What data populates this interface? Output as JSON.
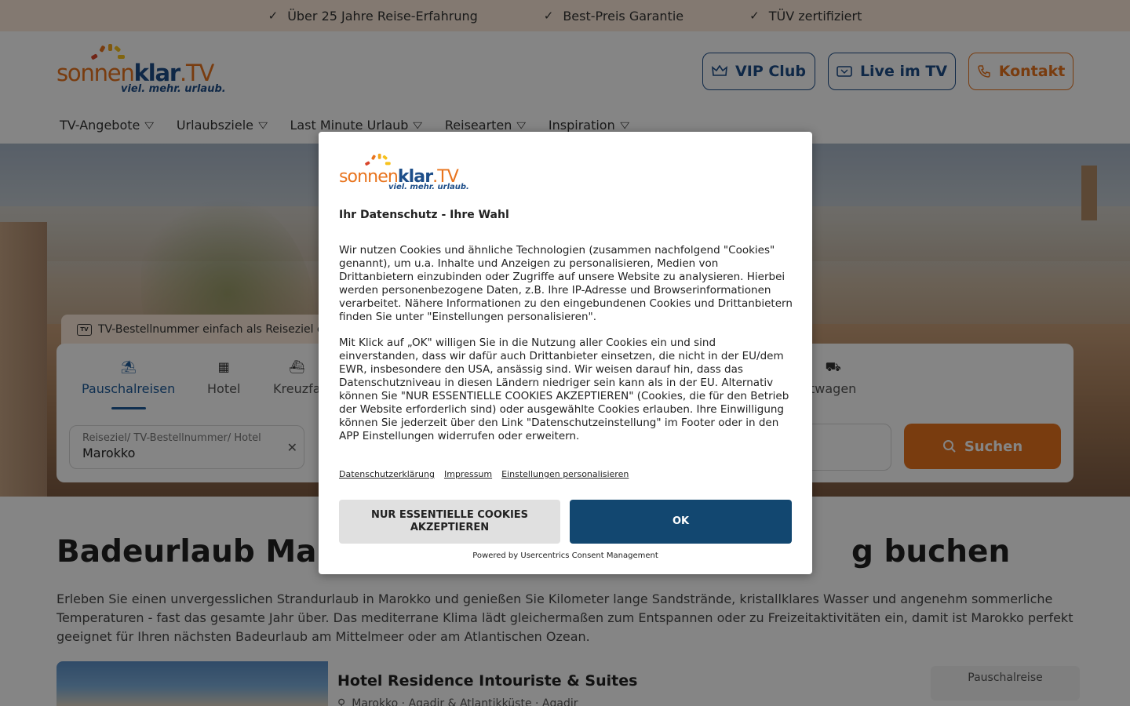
{
  "usp": [
    {
      "label": "Über 25 Jahre Reise-Erfahrung",
      "icon": "check-icon"
    },
    {
      "label": "Best-Preis Garantie",
      "icon": "check-icon"
    },
    {
      "label": "TÜV zertifiziert",
      "icon": "check-icon"
    }
  ],
  "logo": {
    "part1": "sonnen",
    "part2": "klar",
    "part3": ".TV",
    "claim": "viel. mehr. urlaub."
  },
  "header_buttons": {
    "vip": "VIP Club",
    "tv": "Live im TV",
    "kontakt": "Kontakt"
  },
  "nav": [
    "TV-Angebote",
    "Urlaubsziele",
    "Last Minute Urlaub",
    "Reisearten",
    "Inspiration"
  ],
  "search": {
    "tv_hint": "TV-Bestellnummer einfach als Reiseziel e",
    "tabs": [
      {
        "label": "Pauschalreisen",
        "icon": "beach-umbrella-icon"
      },
      {
        "label": "Hotel",
        "icon": "hotel-icon"
      },
      {
        "label": "Kreuzfa",
        "icon": "ship-icon"
      },
      {
        "label": "twagen",
        "icon": "car-icon"
      }
    ],
    "destination_label": "Reiseziel/ TV-Bestellnummer/ Hotel",
    "destination_value": "Marokko",
    "submit": "Suchen"
  },
  "content": {
    "title_left": "Badeurlaub Ma",
    "title_right": "g buchen",
    "intro": "Erleben Sie einen unvergesslichen Strandurlaub in Marokko und genießen Sie Kilometer lange Sandstrände, kristallklares Wasser und angenehm sommerliche Temperaturen - fast das gesamte Jahr über. Das mediterrane Klima lädt gleichermaßen zum Entspannen oder zu Freizeitaktivitäten ein, damit ist Marokko perfekt geeignet für Ihren nächsten Badeurlaub am Mittelmeer oder am Atlantischen Ozean.",
    "hotel": {
      "name": "Hotel Residence Intouriste & Suites",
      "location": "Marokko · Agadir & Atlantikküste · Agadir",
      "tag": "Pauschalreise"
    }
  },
  "consent": {
    "title": "Ihr Datenschutz - Ihre Wahl",
    "paragraph1": "Wir nutzen Cookies und ähnliche Technologien (zusammen nachfolgend \"Cookies\" genannt), um u.a. Inhalte und Anzeigen zu personalisieren, Medien von Drittanbietern einzubinden oder Zugriffe auf unsere Website zu analysieren. Hierbei werden personenbezogene Daten, z.B. Ihre IP-Adresse und Browserinformationen verarbeitet. Nähere Informationen zu den eingebundenen Cookies und Drittanbietern finden Sie unter \"Einstellungen personalisieren\".",
    "paragraph2": "Mit Klick auf „OK\" willigen Sie in die Nutzung aller Cookies ein und sind einverstanden, dass wir dafür auch Drittanbieter einsetzen, die nicht in der EU/dem EWR, insbesondere den USA, ansässig sind. Wir weisen darauf hin, dass das Datenschutzniveau in diesen Ländern niedriger sein kann als in der EU. Alternativ können Sie \"NUR ESSENTIELLE COOKIES AKZEPTIEREN\" (Cookies, die für den Betrieb der Website erforderlich sind) oder ausgewählte Cookies erlauben. Ihre Einwilligung können Sie jederzeit über den Link \"Datenschutzeinstellung\" im Footer oder in den APP Einstellungen widerrufen oder erweitern.",
    "links": [
      "Datenschutzerklärung",
      "Impressum",
      "Einstellungen personalisieren"
    ],
    "deny_button": "NUR ESSENTIELLE COOKIES AKZEPTIEREN",
    "ok_button": "OK",
    "powered_by": "Powered by Usercentrics Consent Management"
  },
  "colors": {
    "brand_orange": "#e8741e",
    "brand_blue": "#1d4e89",
    "ok_button": "#124770"
  }
}
